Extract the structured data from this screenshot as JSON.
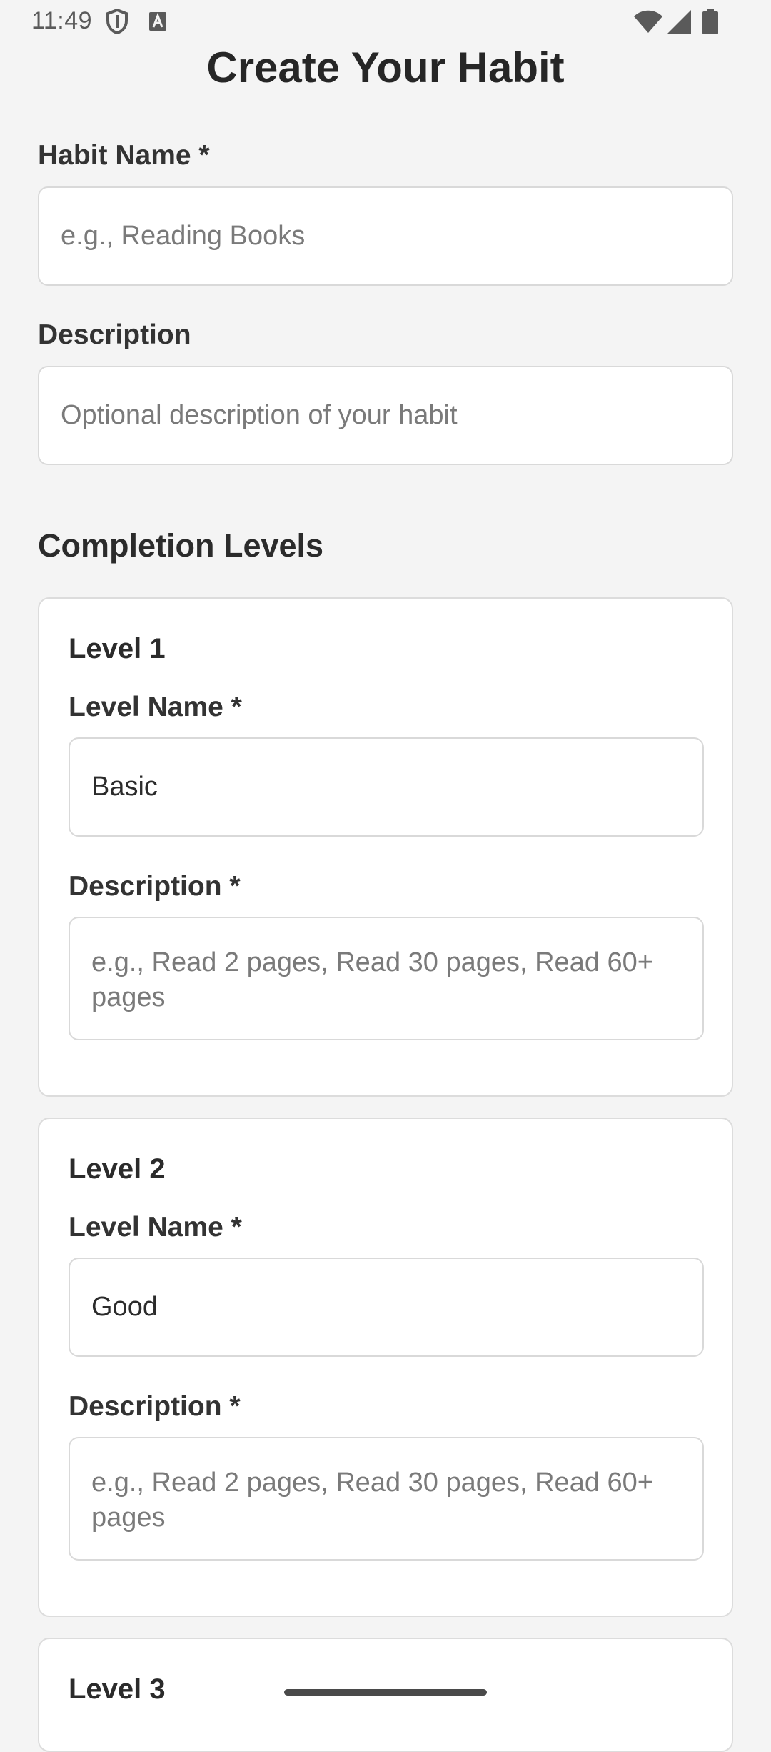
{
  "status_bar": {
    "time": "11:49",
    "icons": [
      "shield-icon",
      "text-notification-icon",
      "wifi-icon",
      "cellular-signal-icon",
      "battery-icon"
    ]
  },
  "page": {
    "title": "Create Your Habit"
  },
  "habit_name": {
    "label": "Habit Name *",
    "placeholder": "e.g., Reading Books",
    "value": ""
  },
  "description": {
    "label": "Description",
    "placeholder": "Optional description of your habit",
    "value": ""
  },
  "completion_levels": {
    "title": "Completion Levels",
    "levels": [
      {
        "title": "Level 1",
        "name_label": "Level Name *",
        "name_value": "Basic",
        "description_label": "Description *",
        "description_placeholder": "e.g., Read 2 pages, Read 30 pages, Read 60+ pages"
      },
      {
        "title": "Level 2",
        "name_label": "Level Name *",
        "name_value": "Good",
        "description_label": "Description *",
        "description_placeholder": "e.g., Read 2 pages, Read 30 pages, Read 60+ pages"
      },
      {
        "title": "Level 3"
      }
    ]
  },
  "colors": {
    "background": "#f4f4f4",
    "card": "#ffffff",
    "border": "#d9d9d9",
    "text": "#2b2b2b",
    "placeholder": "#7a7a7a"
  }
}
